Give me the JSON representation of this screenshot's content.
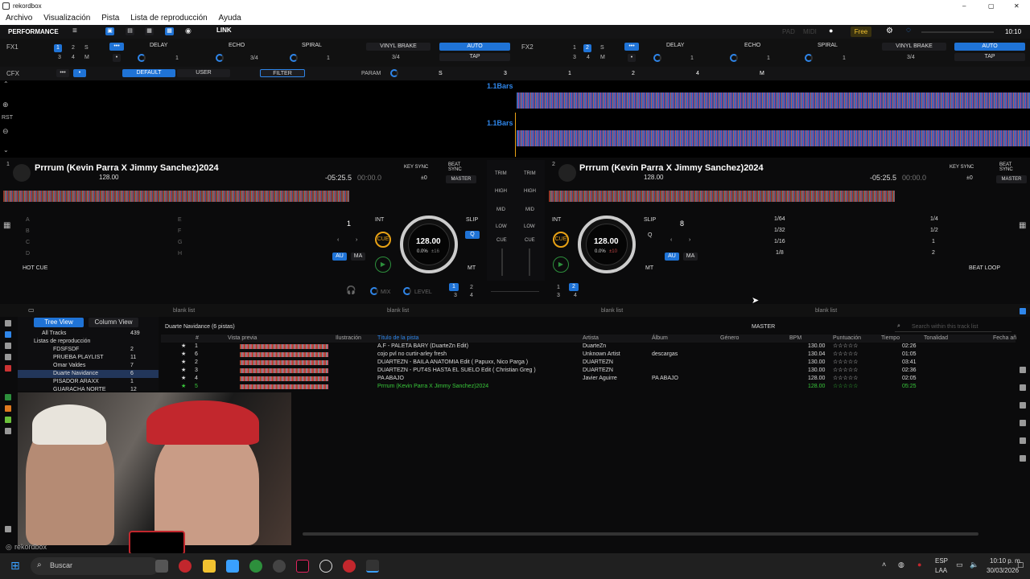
{
  "window": {
    "title": "rekordbox",
    "minimize": "–",
    "maximize": "▢",
    "close": "✕"
  },
  "menu": [
    "Archivo",
    "Visualización",
    "Pista",
    "Lista de reproducción",
    "Ayuda"
  ],
  "topbar": {
    "mode": "PERFORMANCE",
    "link": "LINK",
    "pad": "PAD",
    "midi": "MIDI",
    "plan": "Free",
    "clock": "10:10"
  },
  "fx1": {
    "label": "FX1",
    "nums": [
      "1",
      "2",
      "S",
      "3",
      "4",
      "M"
    ],
    "effects": [
      "DELAY",
      "ECHO",
      "SPIRAL"
    ],
    "beat_vals": [
      "1",
      "3/4",
      "1"
    ],
    "vinyl": "VINYL BRAKE",
    "vinyl_val": "3/4",
    "auto": "AUTO",
    "tap": "TAP"
  },
  "fx2": {
    "label": "FX2",
    "nums": [
      "1",
      "2",
      "S",
      "3",
      "4",
      "M"
    ],
    "effects": [
      "DELAY",
      "ECHO",
      "SPIRAL"
    ],
    "beat_vals": [
      "1",
      "1",
      "1"
    ],
    "vinyl": "VINYL BRAKE",
    "vinyl_val": "3/4",
    "auto": "AUTO",
    "tap": "TAP"
  },
  "cfx": {
    "label": "CFX",
    "default": "DEFAULT",
    "user": "USER",
    "filter": "FILTER",
    "param": "PARAM",
    "keys": [
      "S",
      "3",
      "1",
      "2",
      "4",
      "M"
    ]
  },
  "waveform": {
    "bars_top": "1.1Bars",
    "bars_bottom": "1.1Bars",
    "rst": "RST"
  },
  "deck1": {
    "num": "1",
    "title": "Prrrum (Kevin Parra X Jimmy Sanchez)2024",
    "bpm": "128.00",
    "time_remaining": "-05:25.5",
    "time_elapsed": "00:00.0",
    "key_sync": "KEY SYNC",
    "beat_sync": "BEAT SYNC",
    "key_val": "±0",
    "master": "MASTER",
    "int": "INT",
    "beat_num": "1",
    "cue": "CUE",
    "slip": "SLIP",
    "q": "Q",
    "au": "AU",
    "ma": "MA",
    "mt": "MT",
    "jog_bpm": "128.00",
    "jog_pitch": "0.0%",
    "jog_range": "±16",
    "pads_label": "HOT CUE",
    "pads": [
      "A",
      "B",
      "C",
      "D",
      "E",
      "F",
      "G",
      "H"
    ]
  },
  "deck2": {
    "num": "2",
    "title": "Prrrum (Kevin Parra X Jimmy Sanchez)2024",
    "bpm": "128.00",
    "time_remaining": "-05:25.5",
    "time_elapsed": "00:00.0",
    "key_sync": "KEY SYNC",
    "beat_sync": "BEAT SYNC",
    "key_val": "±0",
    "master": "MASTER",
    "int": "INT",
    "beat_num": "8",
    "cue": "CUE",
    "slip": "SLIP",
    "q": "Q",
    "au": "AU",
    "ma": "MA",
    "mt": "MT",
    "jog_bpm": "128.00",
    "jog_pitch": "0.0%",
    "jog_range": "±10",
    "pads_label": "BEAT LOOP",
    "loops": [
      "1/64",
      "1/4",
      "1/32",
      "1/2",
      "1/16",
      "1",
      "1/8",
      "2"
    ]
  },
  "mixer": {
    "trim": "TRIM",
    "high": "HIGH",
    "mid": "MID",
    "low": "LOW",
    "cue": "CUE",
    "mix": "MIX",
    "level": "LEVEL",
    "ch": [
      "1",
      "2",
      "3",
      "4"
    ]
  },
  "browser": {
    "tabs": [
      "blank list",
      "blank list",
      "blank list",
      "blank list"
    ],
    "tree_view": "Tree View",
    "column_view": "Column View",
    "tree": [
      {
        "label": "All Tracks",
        "count": "439"
      },
      {
        "label": "Listas de reproducción",
        "count": ""
      },
      {
        "label": "FDSFSDF",
        "count": "2"
      },
      {
        "label": "PRUEBA PLAYLIST",
        "count": "11"
      },
      {
        "label": "Omar Valdes",
        "count": "7"
      },
      {
        "label": "Duarte Navidance",
        "count": "6"
      },
      {
        "label": "PISADOR ARAXX",
        "count": "1"
      },
      {
        "label": "GUARACHA NORTE",
        "count": "12"
      }
    ],
    "playlist_title": "Duarte Navidance (6 pistas)",
    "master": "MASTER",
    "search_placeholder": "Search within this track list",
    "columns": [
      "#",
      "Vista previa",
      "Ilustración",
      "Título de la pista",
      "Artista",
      "Álbum",
      "Género",
      "BPM",
      "Puntuación",
      "Tiempo",
      "Tonalidad",
      "Fecha añ"
    ],
    "tracks": [
      {
        "n": "1",
        "title": "A.F - PALETA BARY (DuarteZn Edit)",
        "artist": "DuarteZn",
        "album": "",
        "bpm": "130.00",
        "time": "02:26"
      },
      {
        "n": "6",
        "title": "cojo pvl no curtir-arley fresh",
        "artist": "Unknown Artist",
        "album": "descargas",
        "bpm": "130.04",
        "time": "01:05"
      },
      {
        "n": "2",
        "title": "DUARTEZN - BAILA ANATOMIA Edit ( Papuxx, Nico Parga )",
        "artist": "DUARTEZN",
        "album": "",
        "bpm": "130.00",
        "time": "03:41"
      },
      {
        "n": "3",
        "title": "DUARTEZN - PUT4S HASTA EL SUELO Edit ( Christian Greg )",
        "artist": "DUARTEZN",
        "album": "",
        "bpm": "130.00",
        "time": "02:36"
      },
      {
        "n": "4",
        "title": "PA ABAJO",
        "artist": "Javier Aguirre",
        "album": "PA ABAJO",
        "bpm": "128.00",
        "time": "02:05"
      },
      {
        "n": "5",
        "title": "Prrrum (Kevin Parra X Jimmy Sanchez)2024",
        "artist": "",
        "album": "",
        "bpm": "128.00",
        "time": "05:25"
      }
    ]
  },
  "brand": "rekordbox",
  "taskbar": {
    "search": "Buscar",
    "lang1": "ESP",
    "lang2": "LAA",
    "time": "10:10 p. m.",
    "date": "30/03/2026"
  },
  "colors": {
    "accent": "#1f73d6",
    "play": "#2d8f3c",
    "cue": "#e9a215",
    "playing_row": "#39c93b"
  }
}
